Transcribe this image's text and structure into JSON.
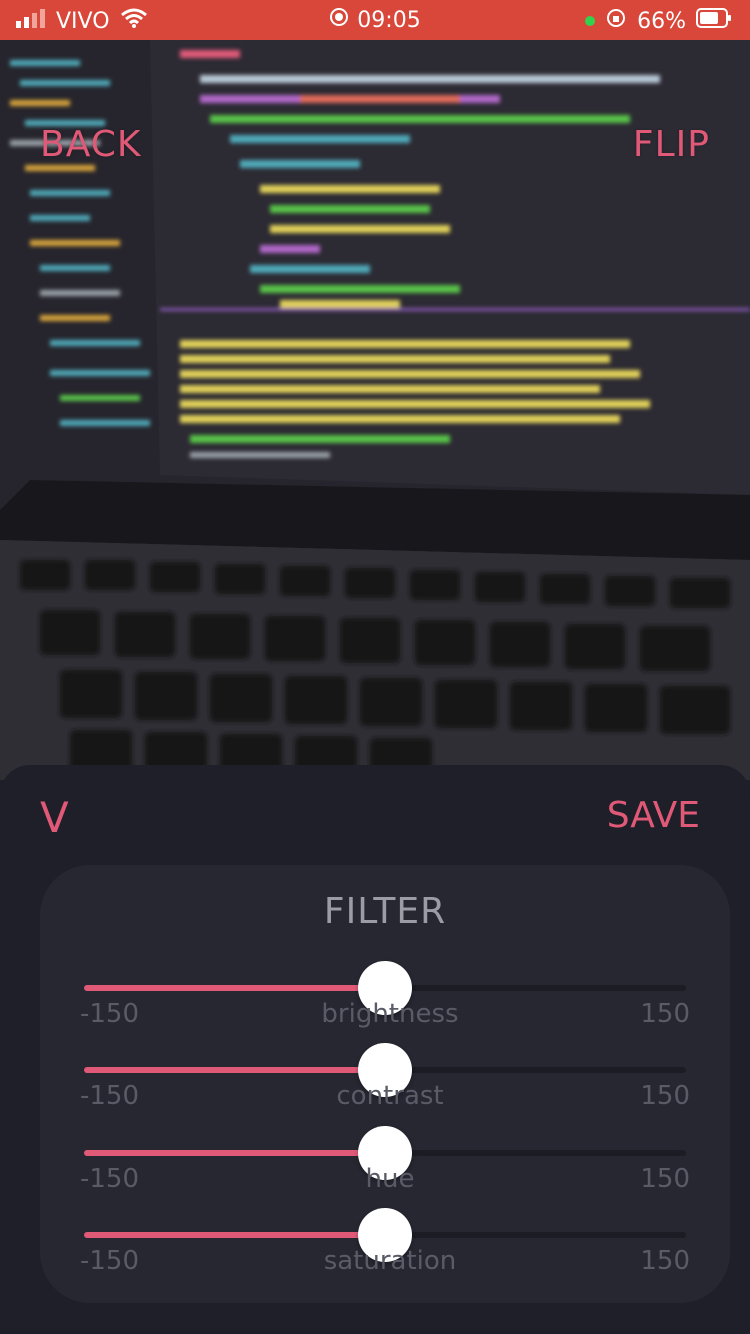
{
  "status_bar": {
    "carrier": "VIVO",
    "time": "09:05",
    "battery": "66%"
  },
  "camera": {
    "back_label": "BACK",
    "flip_label": "FLIP"
  },
  "sheet": {
    "collapse_label": "V",
    "save_label": "SAVE",
    "filter_title": "FILTER",
    "sliders": [
      {
        "name": "brightness",
        "min": "-150",
        "max": "150",
        "value": 0
      },
      {
        "name": "contrast",
        "min": "-150",
        "max": "150",
        "value": 0
      },
      {
        "name": "hue",
        "min": "-150",
        "max": "150",
        "value": 0
      },
      {
        "name": "saturation",
        "min": "-150",
        "max": "150",
        "value": 0
      }
    ]
  },
  "colors": {
    "accent": "#e05a78",
    "status_bar": "#d9473a",
    "sheet_bg": "#1e1f28",
    "panel_bg": "#262731"
  }
}
